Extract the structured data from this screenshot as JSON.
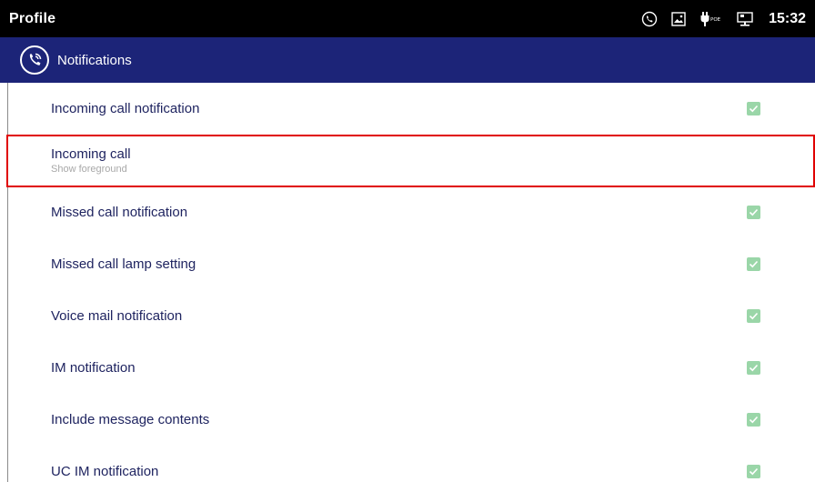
{
  "statusbar": {
    "title": "Profile",
    "time": "15:32",
    "icons": [
      "call-status-icon",
      "gallery-icon",
      "poe-icon",
      "network-icon"
    ]
  },
  "appbar": {
    "icon": "phone-call-icon",
    "label": "Notifications"
  },
  "settings": [
    {
      "label": "Incoming call notification",
      "checked": true
    },
    {
      "label": "Incoming call",
      "subtitle": "Show foreground"
    },
    {
      "label": "Missed call notification",
      "checked": true
    },
    {
      "label": "Missed call lamp setting",
      "checked": true
    },
    {
      "label": "Voice mail notification",
      "checked": true
    },
    {
      "label": "IM notification",
      "checked": true
    },
    {
      "label": "Include message contents",
      "checked": true
    },
    {
      "label": "UC IM notification",
      "checked": true
    }
  ],
  "colors": {
    "statusbar_bg": "#000000",
    "appbar_bg": "#1c2478",
    "label_text": "#1f2460",
    "checkbox_fill": "#9ad6a8",
    "highlight_border": "#e00000"
  }
}
